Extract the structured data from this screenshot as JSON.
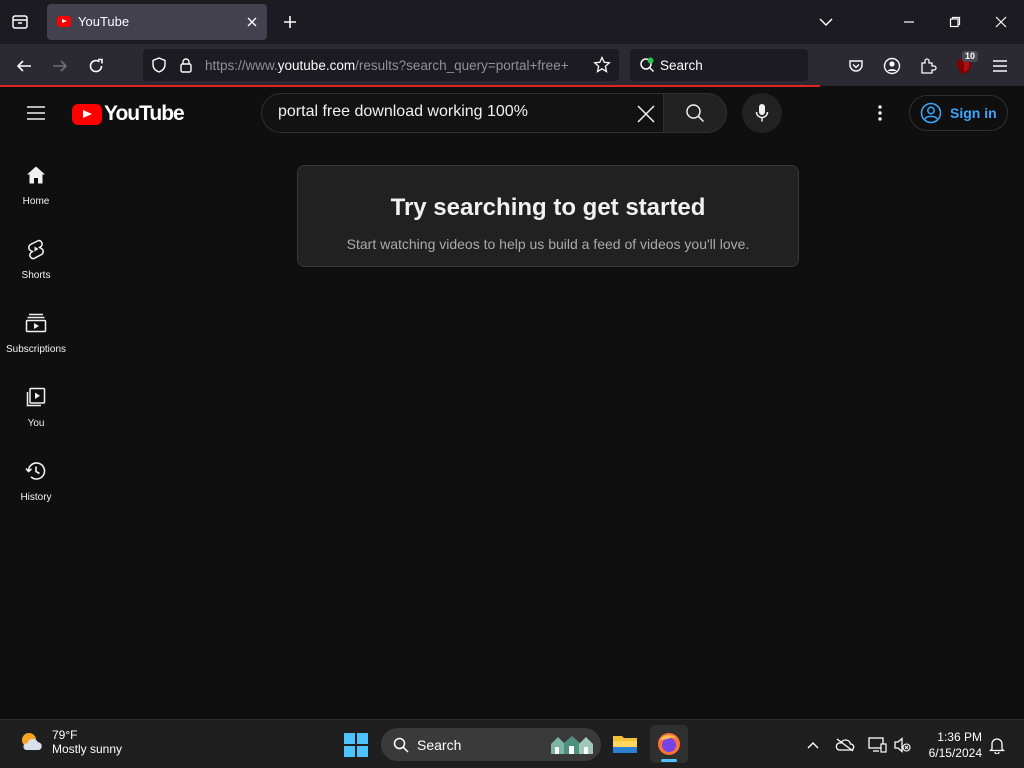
{
  "browser": {
    "tab_title": "YouTube",
    "url_prefix": "https://www.",
    "url_domain": "youtube.com",
    "url_rest": "/results?search_query=portal+free+",
    "search_label": "Search",
    "extension_badge": "10"
  },
  "youtube": {
    "logo_text": "YouTube",
    "search_value": "portal free download working 100%",
    "signin_label": "Sign in",
    "nav": [
      {
        "label": "Home"
      },
      {
        "label": "Shorts"
      },
      {
        "label": "Subscriptions"
      },
      {
        "label": "You"
      },
      {
        "label": "History"
      }
    ],
    "empty_title": "Try searching to get started",
    "empty_text": "Start watching videos to help us build a feed of videos you'll love."
  },
  "taskbar": {
    "temperature": "79°F",
    "condition": "Mostly sunny",
    "search_label": "Search",
    "time": "1:36 PM",
    "date": "6/15/2024"
  },
  "colors": {
    "brand_red": "#ff0000",
    "link_blue": "#3ea6ff",
    "page_bg": "#0f0f0f"
  }
}
